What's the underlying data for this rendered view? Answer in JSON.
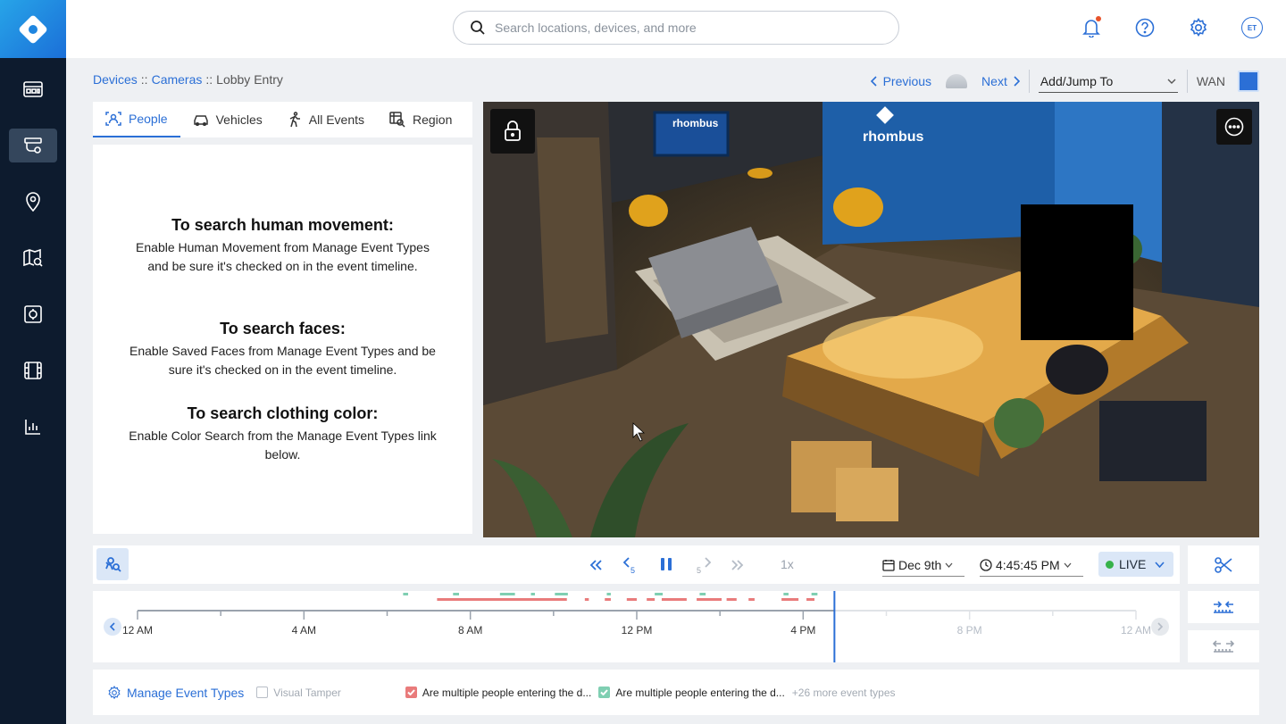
{
  "app": {
    "nav": {
      "items": [
        {
          "name": "dashboard",
          "icon": "dashboard-icon"
        },
        {
          "name": "devices",
          "icon": "camera-devices-icon",
          "active": true
        },
        {
          "name": "locations",
          "icon": "location-pin-icon"
        },
        {
          "name": "map-search",
          "icon": "map-search-icon"
        },
        {
          "name": "access-control",
          "icon": "access-control-icon"
        },
        {
          "name": "video-wall",
          "icon": "film-icon"
        },
        {
          "name": "reports",
          "icon": "bar-chart-icon"
        }
      ]
    },
    "topbar": {
      "search_placeholder": "Search locations, devices, and more",
      "avatar_initials": "ET"
    },
    "breadcrumb": {
      "devices": "Devices",
      "sep1": "::",
      "cameras": "Cameras",
      "sep2": "::",
      "current": "Lobby Entry"
    },
    "pager": {
      "previous": "Previous",
      "next": "Next",
      "jump_label": "Add/Jump To",
      "network": "WAN"
    },
    "tabs": [
      {
        "label": "People",
        "icon": "person-search-icon",
        "active": true
      },
      {
        "label": "Vehicles",
        "icon": "car-icon"
      },
      {
        "label": "All Events",
        "icon": "walking-icon"
      },
      {
        "label": "Region",
        "icon": "region-search-icon"
      }
    ],
    "help": [
      {
        "title": "To search human movement:",
        "body": "Enable Human Movement from Manage Event Types and be sure it's checked on in the event timeline."
      },
      {
        "title": "To search faces:",
        "body": "Enable Saved Faces from Manage Event Types and be sure it's checked on in the event timeline."
      },
      {
        "title": "To search clothing color:",
        "body": "Enable Color Search from the Manage Event Types link below."
      }
    ],
    "video": {
      "wall_logo": "rhombus",
      "screen_logo": "rhombus"
    },
    "controls": {
      "speed": "1x",
      "date": "Dec 9th",
      "time": "4:45:45 PM",
      "live": "LIVE",
      "skip_seconds": "5"
    },
    "timeline": {
      "labels": [
        "12 AM",
        "4 AM",
        "8 AM",
        "12 PM",
        "4 PM",
        "8 PM",
        "12 AM"
      ],
      "current_time_fraction": 0.698
    },
    "events": {
      "manage": "Manage Event Types",
      "visual_tamper": "Visual Tamper",
      "event_red": "Are multiple people entering the d...",
      "event_green": "Are multiple people entering the d...",
      "more": "+26 more event types"
    },
    "colors": {
      "accent": "#2b6fd6",
      "nav_bg": "#0d1b2e",
      "live_green": "#36b24a",
      "event_red": "#e97b7b",
      "event_green": "#7fcfb2"
    }
  }
}
